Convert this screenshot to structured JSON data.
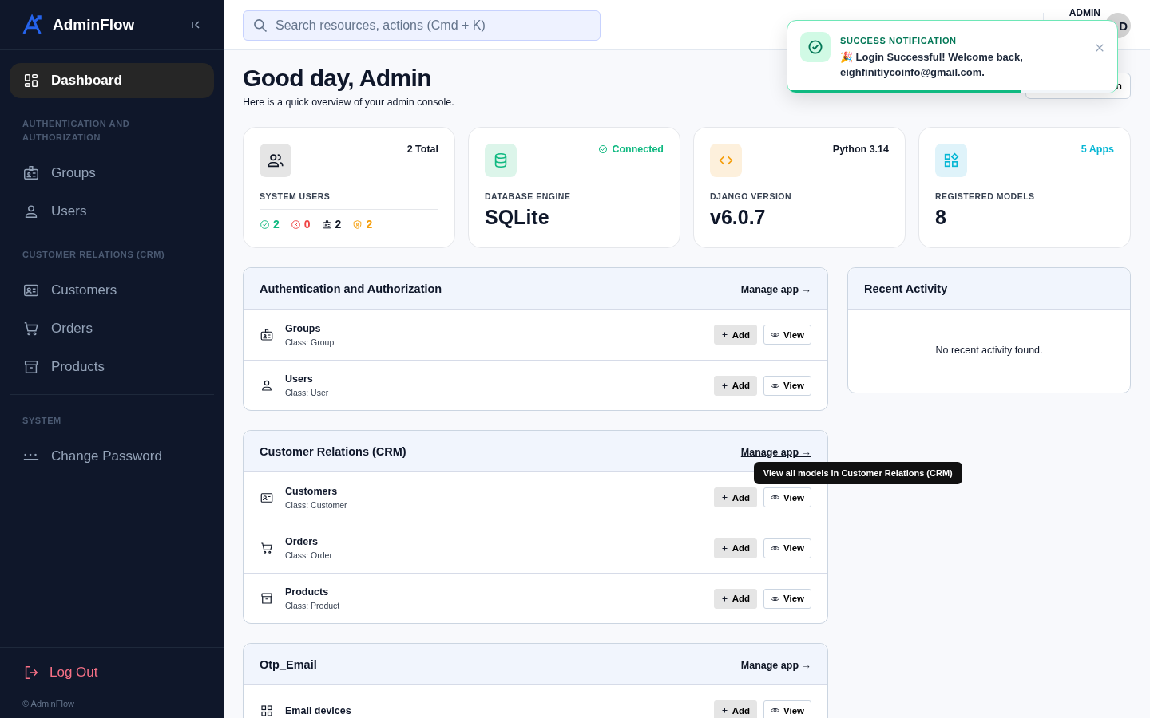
{
  "sidebar": {
    "brand": "AdminFlow",
    "sections": [
      {
        "items": [
          {
            "label": "Dashboard",
            "kind": "dashboard",
            "selected": true
          }
        ]
      },
      {
        "heading": "AUTHENTICATION AND AUTHORIZATION",
        "items": [
          {
            "label": "Groups",
            "kind": "badge",
            "selected": false
          },
          {
            "label": "Users",
            "kind": "user",
            "selected": false
          }
        ]
      },
      {
        "heading": "CUSTOMER RELATIONS (CRM)",
        "items": [
          {
            "label": "Customers",
            "kind": "card",
            "selected": false
          },
          {
            "label": "Orders",
            "kind": "cart",
            "selected": false
          },
          {
            "label": "Products",
            "kind": "archive",
            "selected": false
          }
        ]
      },
      {
        "heading": "SYSTEM",
        "items": [
          {
            "label": "Change Password",
            "kind": "password",
            "selected": false
          }
        ]
      }
    ],
    "logout": "Log Out",
    "footer": "© AdminFlow"
  },
  "header": {
    "search_placeholder": "Search resources, actions (Cmd + K)",
    "user": "ADMIN",
    "avatar": "D"
  },
  "toast": {
    "title": "SUCCESS NOTIFICATION",
    "message": "🎉 Login Successful! Welcome back, eighfinitiycoinfo@gmail.com.",
    "level": 0.71
  },
  "greeting": {
    "title": "Good day, Admin",
    "subtitle": "Here is a quick overview of your admin console.",
    "button": "n"
  },
  "cards": [
    {
      "kind": "users",
      "badge": "2 Total",
      "label": "SYSTEM USERS",
      "stats": [
        {
          "kind": "check",
          "value": "2",
          "color": "#10b981"
        },
        {
          "kind": "cross",
          "value": "0",
          "color": "#ef4444"
        },
        {
          "kind": "badge",
          "value": "2",
          "color": "#111827"
        },
        {
          "kind": "shield",
          "value": "2",
          "color": "#f59e0b"
        }
      ]
    },
    {
      "kind": "database",
      "badge": "Connected",
      "label": "DATABASE ENGINE",
      "value": "SQLite"
    },
    {
      "kind": "code",
      "badge": "Python 3.14",
      "label": "DJANGO VERSION",
      "value": "v6.0.7"
    },
    {
      "kind": "apps",
      "badge": "5 Apps",
      "label": "REGISTERED MODELS",
      "value": "8"
    }
  ],
  "apps": [
    {
      "title": "Authentication and Authorization",
      "manage": "Manage app →",
      "models": [
        {
          "name": "Groups",
          "class": "Class: Group",
          "kind": "badge",
          "add": "Add",
          "view": "View"
        },
        {
          "name": "Users",
          "class": "Class: User",
          "kind": "user",
          "add": "Add",
          "view": "View"
        }
      ]
    },
    {
      "title": "Customer Relations (CRM)",
      "manage": "Manage app →",
      "tooltip": "View all models in Customer Relations (CRM)",
      "models": [
        {
          "name": "Customers",
          "class": "Class: Customer",
          "kind": "card",
          "add": "Add",
          "view": "View"
        },
        {
          "name": "Orders",
          "class": "Class: Order",
          "kind": "cart",
          "add": "Add",
          "view": "View"
        },
        {
          "name": "Products",
          "class": "Class: Product",
          "kind": "archive",
          "add": "Add",
          "view": "View"
        }
      ]
    },
    {
      "title": "Otp_Email",
      "manage": "Manage app →",
      "models": [
        {
          "name": "Email devices",
          "kind": "grid",
          "add": "Add",
          "view": "View"
        }
      ]
    }
  ],
  "activity": {
    "title": "Recent Activity",
    "empty": "No recent activity found."
  }
}
